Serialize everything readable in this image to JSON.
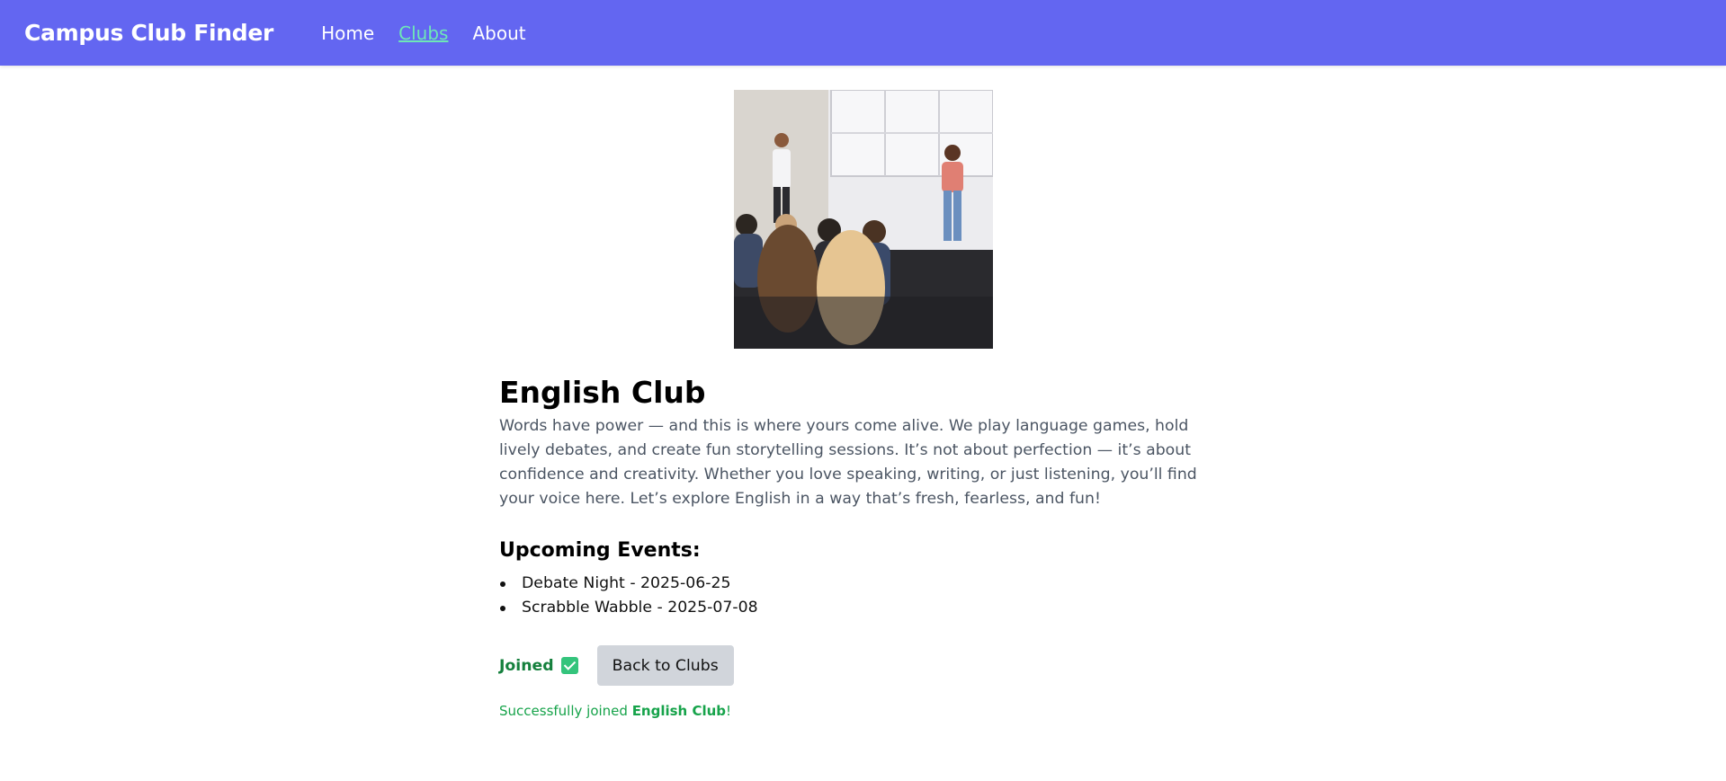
{
  "navbar": {
    "brand": "Campus Club Finder",
    "links": [
      {
        "label": "Home"
      },
      {
        "label": "Clubs"
      },
      {
        "label": "About"
      }
    ],
    "active": "Clubs"
  },
  "club": {
    "image_icon": "club-photo",
    "title": "English Club",
    "description": "Words have power — and this is where yours come alive. We play language games, hold lively debates, and create fun storytelling sessions. It’s not about perfection — it’s about confidence and creativity. Whether you love speaking, writing, or just listening, you’ll find your voice here. Let’s explore English in a way that’s fresh, fearless, and fun!",
    "events_heading": "Upcoming Events:",
    "events": [
      "Debate Night - 2025-06-25",
      "Scrabble Wabble - 2025-07-08"
    ]
  },
  "actions": {
    "joined_label": "Joined",
    "joined_icon": "checkmark-icon",
    "back_button": "Back to Clubs"
  },
  "message": {
    "prefix": "Successfully joined ",
    "club_name": "English Club",
    "suffix": "!"
  },
  "colors": {
    "navbar": "#6366f1",
    "active_link": "#6ee7b7",
    "joined": "#15803d",
    "success": "#16a34a",
    "button_bg": "#d1d5db"
  }
}
